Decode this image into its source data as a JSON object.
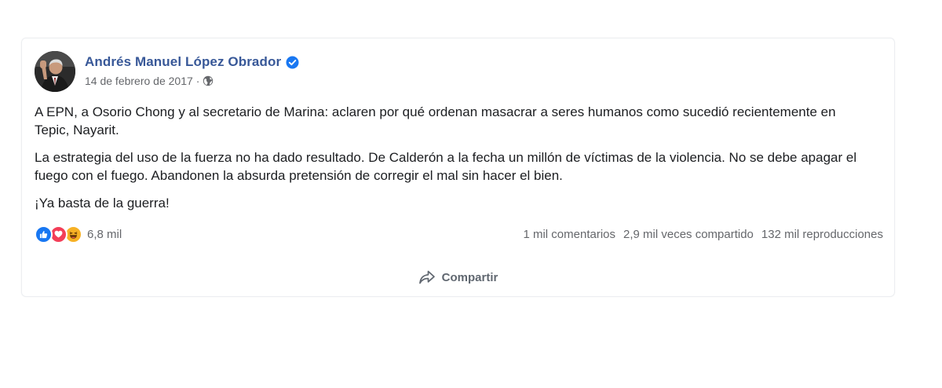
{
  "post": {
    "author": {
      "name": "Andrés Manuel López Obrador",
      "verified": true,
      "avatar_icon": "profile-photo"
    },
    "date": "14 de febrero de 2017",
    "separator": "·",
    "audience_icon": "globe-icon",
    "paragraphs": [
      "A EPN, a Osorio Chong y al secretario de Marina: aclaren por qué ordenan masacrar a seres humanos como sucedió recientemente en Tepic, Nayarit.",
      "La estrategia del uso de la fuerza no ha dado resultado. De Calderón a la fecha un millón de víctimas de la violencia. No se debe apagar el fuego con el fuego. Abandonen la absurda pretensión de corregir el mal sin hacer el bien.",
      "¡Ya basta de la guerra!"
    ],
    "reactions": {
      "icons": [
        "like-icon",
        "love-icon",
        "haha-icon"
      ],
      "count": "6,8 mil"
    },
    "stats": {
      "comments": "1 mil comentarios",
      "shares": "2,9 mil veces compartido",
      "views": "132 mil reproducciones"
    },
    "actions": {
      "share_label": "Compartir"
    }
  },
  "colors": {
    "author_link": "#385898",
    "verified_badge": "#1877f2",
    "like": "#1877f2",
    "love": "#f33e58",
    "haha": "#f7b125",
    "muted_text": "#65676b"
  }
}
